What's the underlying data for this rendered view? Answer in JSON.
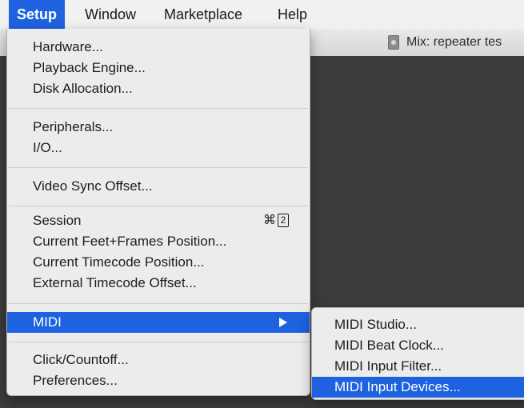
{
  "menubar": {
    "items": [
      {
        "label": "Setup"
      },
      {
        "label": "Window"
      },
      {
        "label": "Marketplace"
      },
      {
        "label": "Help"
      }
    ]
  },
  "window": {
    "title": "Mix: repeater tes"
  },
  "setup_menu": {
    "hardware": "Hardware...",
    "playback_engine": "Playback Engine...",
    "disk_allocation": "Disk Allocation...",
    "peripherals": "Peripherals...",
    "io": "I/O...",
    "video_sync_offset": "Video Sync Offset...",
    "session": "Session",
    "session_shortcut_symbol": "⌘",
    "session_shortcut_key": "2",
    "current_feet_frames": "Current Feet+Frames Position...",
    "current_timecode": "Current Timecode Position...",
    "external_timecode_offset": "External Timecode Offset...",
    "midi": "MIDI",
    "click_countoff": "Click/Countoff...",
    "preferences": "Preferences..."
  },
  "midi_submenu": {
    "items": [
      {
        "label": "MIDI Studio..."
      },
      {
        "label": "MIDI Beat Clock..."
      },
      {
        "label": "MIDI Input Filter..."
      },
      {
        "label": "MIDI Input Devices..."
      }
    ]
  },
  "colors": {
    "highlight": "#1f62e0",
    "menu_bg": "#ececec",
    "window_bg": "#3c3c3c"
  }
}
